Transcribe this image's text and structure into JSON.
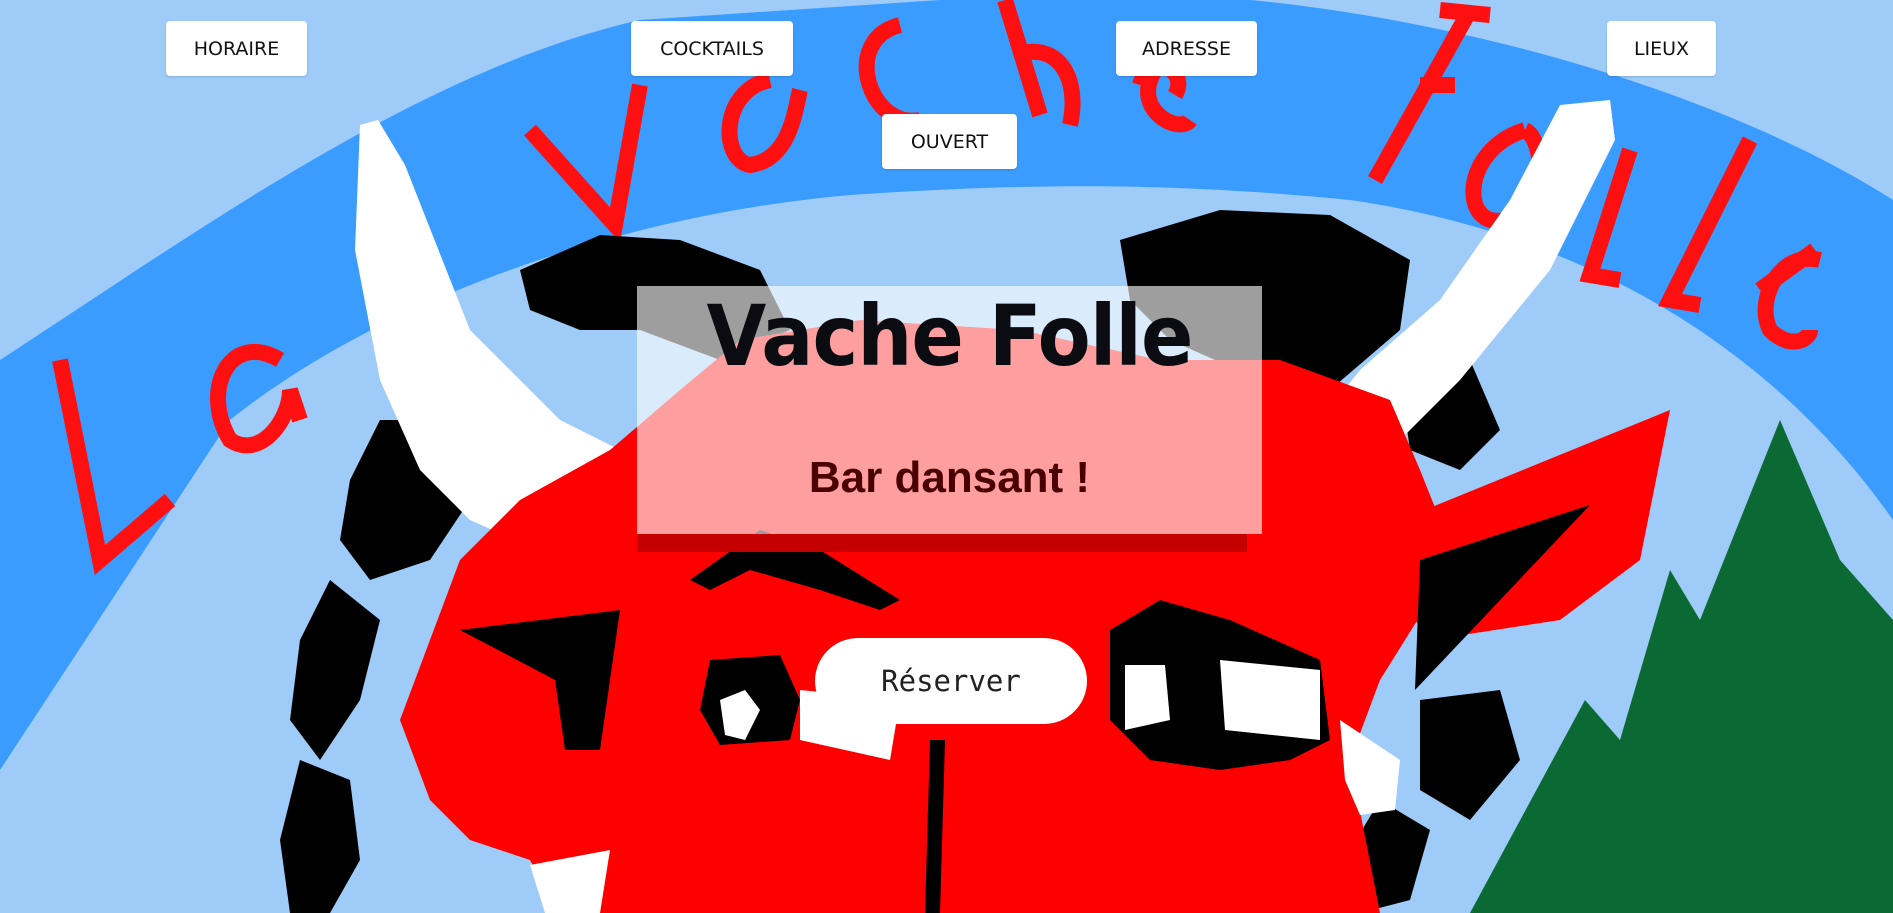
{
  "nav": {
    "horaire": "HORAIRE",
    "cocktails": "COCKTAILS",
    "adresse": "ADRESSE",
    "lieux": "LIEUX",
    "ouvert": "OUVERT"
  },
  "hero": {
    "title": "Vache Folle",
    "subtitle": "Bar dansant !",
    "reserve_label": "Réserver"
  },
  "background": {
    "banner_text": "La Vache Folle",
    "colors": {
      "sky": "#9ecbf7",
      "banner": "#3b9cff",
      "banner_text": "#ff1010",
      "cow": "#ff0000",
      "horns": "#ffffff",
      "fur": "#000000",
      "mountain": "#0b6a33"
    }
  }
}
